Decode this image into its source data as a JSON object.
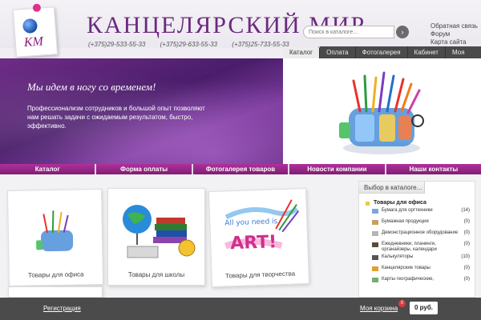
{
  "header": {
    "brand": "Канцелярский Мир",
    "logo_mono": "КМ",
    "phones": [
      "(+375)29-533-55-33",
      "(+375)29-633-55-33",
      "(+375)25-733-55-33"
    ],
    "search_placeholder": "Поиск в каталоге...",
    "search_icon": "arrow-right-icon",
    "links": [
      "Обратная связь",
      "Форум",
      "Карта сайта"
    ]
  },
  "tabs": [
    "Каталог",
    "Оплата",
    "Фотогалерея",
    "Кабинет",
    "Моя корзина"
  ],
  "hero": {
    "title": "Мы идем в ногу со временем!",
    "text": "Профессионализм сотрудников и большой опыт позволяют нам решать задачи с ожидаемым результатом, быстро, эффективно."
  },
  "subnav": [
    "Каталог",
    "Форма оплаты",
    "Фотогалерея товаров",
    "Новости компании",
    "Наши контакты"
  ],
  "cards": [
    {
      "label": "Товары для офиса"
    },
    {
      "label": "Товары для школы"
    },
    {
      "label": "Товары для творчества",
      "art_text": "All you need is ART!"
    }
  ],
  "sidebar": {
    "tab_label": "Выбор в каталоге...",
    "group": "Товары для офиса",
    "items": [
      {
        "label": "Бумага для оргтехники",
        "count": "(14)"
      },
      {
        "label": "Бумажная продукция",
        "count": "(0)"
      },
      {
        "label": "Демонстрационное оборудование",
        "count": "(0)"
      },
      {
        "label": "Ежедневники, планинги, органайзеры, календари",
        "count": "(0)"
      },
      {
        "label": "Калькуляторы",
        "count": "(10)"
      },
      {
        "label": "Канцелярские товары",
        "count": "(0)"
      },
      {
        "label": "Карты географические,",
        "count": "(0)"
      }
    ]
  },
  "footer": {
    "register": "Регистрация",
    "cart": "Моя корзина",
    "badge": "0",
    "sum": "0 руб."
  },
  "colors": {
    "accent": "#8b1a78",
    "nav": "#4a4a4a",
    "subnav": "#a52b93"
  }
}
